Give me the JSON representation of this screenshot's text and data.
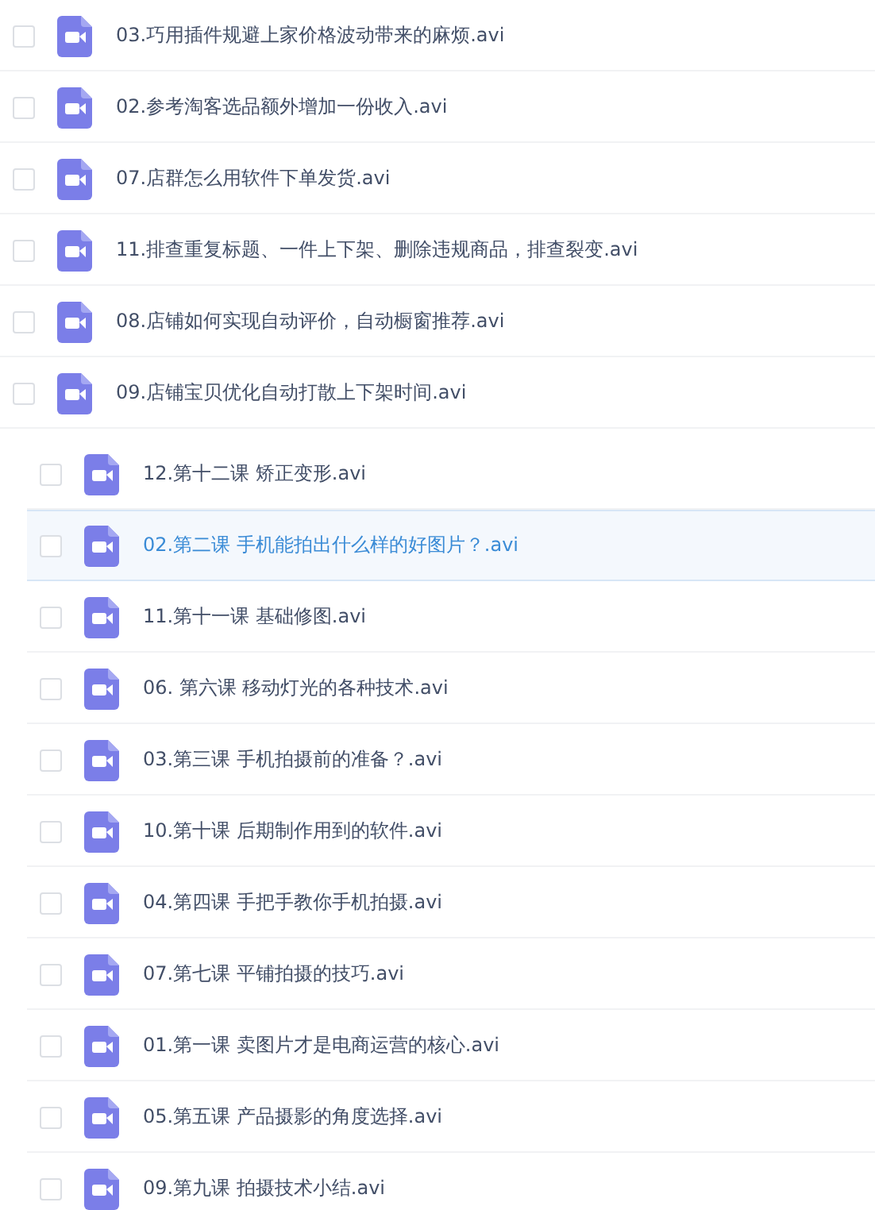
{
  "files": [
    {
      "name": "03.巧用插件规避上家价格波动带来的麻烦.avi",
      "checked": false,
      "selected": false
    },
    {
      "name": "02.参考淘客选品额外增加一份收入.avi",
      "checked": false,
      "selected": false
    },
    {
      "name": "07.店群怎么用软件下单发货.avi",
      "checked": false,
      "selected": false
    },
    {
      "name": "11.排查重复标题、一件上下架、删除违规商品，排查裂变.avi",
      "checked": false,
      "selected": false
    },
    {
      "name": "08.店铺如何实现自动评价，自动橱窗推荐.avi",
      "checked": false,
      "selected": false
    },
    {
      "name": "09.店铺宝贝优化自动打散上下架时间.avi",
      "checked": false,
      "selected": false,
      "children": [
        {
          "name": "12.第十二课 矫正变形.avi",
          "checked": false,
          "selected": false
        },
        {
          "name": "02.第二课 手机能拍出什么样的好图片？.avi",
          "checked": false,
          "selected": true
        },
        {
          "name": "11.第十一课 基础修图.avi",
          "checked": false,
          "selected": false
        },
        {
          "name": "06. 第六课 移动灯光的各种技术.avi",
          "checked": false,
          "selected": false
        },
        {
          "name": "03.第三课 手机拍摄前的准备？.avi",
          "checked": false,
          "selected": false
        },
        {
          "name": "10.第十课 后期制作用到的软件.avi",
          "checked": false,
          "selected": false
        },
        {
          "name": "04.第四课 手把手教你手机拍摄.avi",
          "checked": false,
          "selected": false
        },
        {
          "name": "07.第七课 平铺拍摄的技巧.avi",
          "checked": false,
          "selected": false
        },
        {
          "name": "01.第一课 卖图片才是电商运营的核心.avi",
          "checked": false,
          "selected": false
        },
        {
          "name": "05.第五课 产品摄影的角度选择.avi",
          "checked": false,
          "selected": false
        },
        {
          "name": "09.第九课 拍摄技术小结.avi",
          "checked": false,
          "selected": false
        }
      ]
    }
  ]
}
